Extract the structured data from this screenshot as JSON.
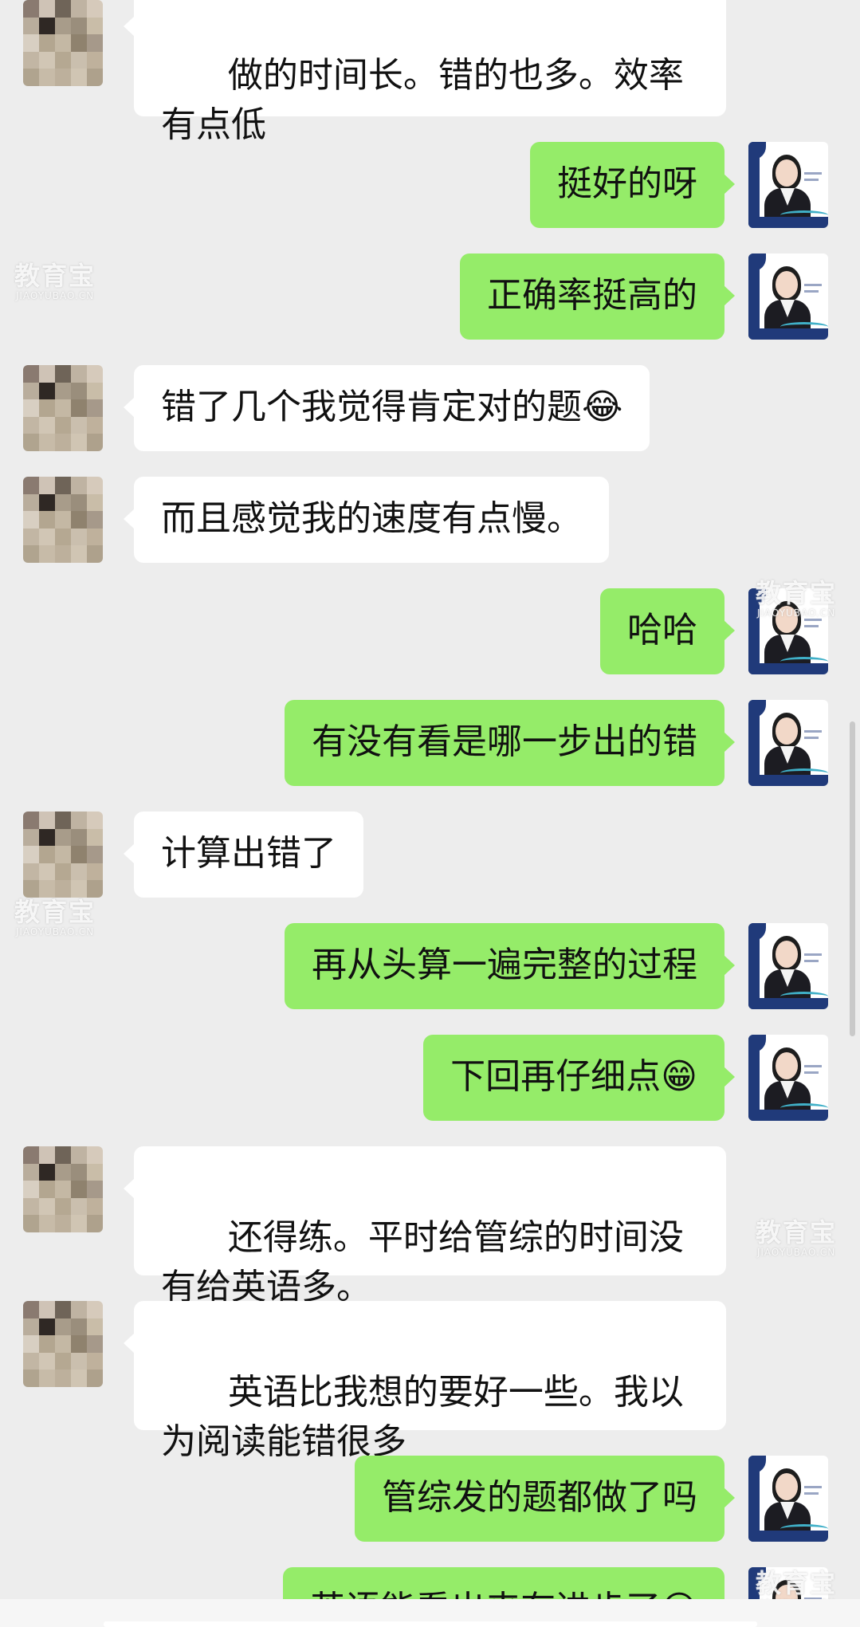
{
  "theme": {
    "background": "#ededed",
    "incoming_bubble": "#ffffff",
    "outgoing_bubble": "#95ec69"
  },
  "messages": [
    {
      "side": "left",
      "text": "做的时间长。错的也多。效率有点低"
    },
    {
      "side": "right",
      "text": "挺好的呀"
    },
    {
      "side": "right",
      "text": "正确率挺高的"
    },
    {
      "side": "left",
      "text": "错了几个我觉得肯定对的题😂"
    },
    {
      "side": "left",
      "text": "而且感觉我的速度有点慢。"
    },
    {
      "side": "right",
      "text": "哈哈"
    },
    {
      "side": "right",
      "text": "有没有看是哪一步出的错"
    },
    {
      "side": "left",
      "text": "计算出错了"
    },
    {
      "side": "right",
      "text": "再从头算一遍完整的过程"
    },
    {
      "side": "right",
      "text": "下回再仔细点😁"
    },
    {
      "side": "left",
      "text": "还得练。平时给管综的时间没有给英语多。"
    },
    {
      "side": "left",
      "text": "英语比我想的要好一些。我以为阅读能错很多"
    },
    {
      "side": "right",
      "text": "管综发的题都做了吗"
    },
    {
      "side": "right",
      "text": "英语能看出来有进步了😊"
    }
  ],
  "watermark": {
    "main": "教育宝",
    "sub": "JIAOYUBAO.CN"
  },
  "avatars": {
    "contact": "pixelated-avatar",
    "teacher": "teacher-portrait-avatar"
  }
}
